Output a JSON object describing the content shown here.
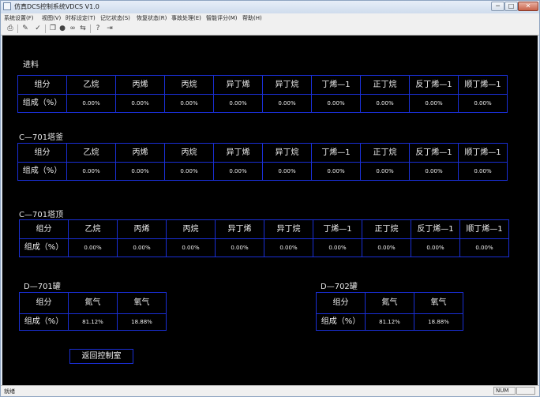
{
  "window": {
    "title": "仿真DCS控制系统VDCS V1.0",
    "controls": {
      "minimize": "─",
      "maximize": "□",
      "close": "✕"
    }
  },
  "menu": [
    "系统设置(F)",
    "视图(V)",
    "时标设定(T)",
    "记忆状态(S)",
    "恢复状态(R)",
    "事故处理(E)",
    "智能评分(M)",
    "帮助(H)"
  ],
  "toolbar": [
    "print-icon",
    "pencil-icon",
    "check-icon",
    "copy-icon",
    "record-icon",
    "tape-icon",
    "export-icon",
    "help-icon",
    "exit-icon"
  ],
  "sections": {
    "feed": {
      "title": "进料",
      "header_label": "组分",
      "row_label": "组成（%）",
      "columns": [
        "乙烷",
        "丙烯",
        "丙烷",
        "异丁烯",
        "异丁烷",
        "丁烯—1",
        "正丁烷",
        "反丁烯—1",
        "顺丁烯—1"
      ],
      "values": [
        "0.00%",
        "0.00%",
        "0.00%",
        "0.00%",
        "0.00%",
        "0.00%",
        "0.00%",
        "0.00%",
        "0.00%"
      ]
    },
    "kettle": {
      "title": "C—701塔釜",
      "header_label": "组分",
      "row_label": "组成（%）",
      "columns": [
        "乙烷",
        "丙烯",
        "丙烷",
        "异丁烯",
        "异丁烷",
        "丁烯—1",
        "正丁烷",
        "反丁烯—1",
        "顺丁烯—1"
      ],
      "values": [
        "0.00%",
        "0.00%",
        "0.00%",
        "0.00%",
        "0.00%",
        "0.00%",
        "0.00%",
        "0.00%",
        "0.00%"
      ]
    },
    "top": {
      "title": "C—701塔顶",
      "header_label": "组分",
      "row_label": "组成（%）",
      "columns": [
        "乙烷",
        "丙烯",
        "丙烷",
        "异丁烯",
        "异丁烷",
        "丁烯—1",
        "正丁烷",
        "反丁烯—1",
        "顺丁烯—1"
      ],
      "values": [
        "0.00%",
        "0.00%",
        "0.00%",
        "0.00%",
        "0.00%",
        "0.00%",
        "0.00%",
        "0.00%",
        "0.00%"
      ]
    },
    "d701": {
      "title": "D—701罐",
      "header_label": "组分",
      "row_label": "组成（%）",
      "columns": [
        "氮气",
        "氧气"
      ],
      "values": [
        "81.12%",
        "18.88%"
      ]
    },
    "d702": {
      "title": "D—702罐",
      "header_label": "组分",
      "row_label": "组成（%）",
      "columns": [
        "氮气",
        "氧气"
      ],
      "values": [
        "81.12%",
        "18.88%"
      ]
    }
  },
  "return_button": "返回控制室",
  "status": {
    "left": "就绪",
    "num": "NUM"
  }
}
